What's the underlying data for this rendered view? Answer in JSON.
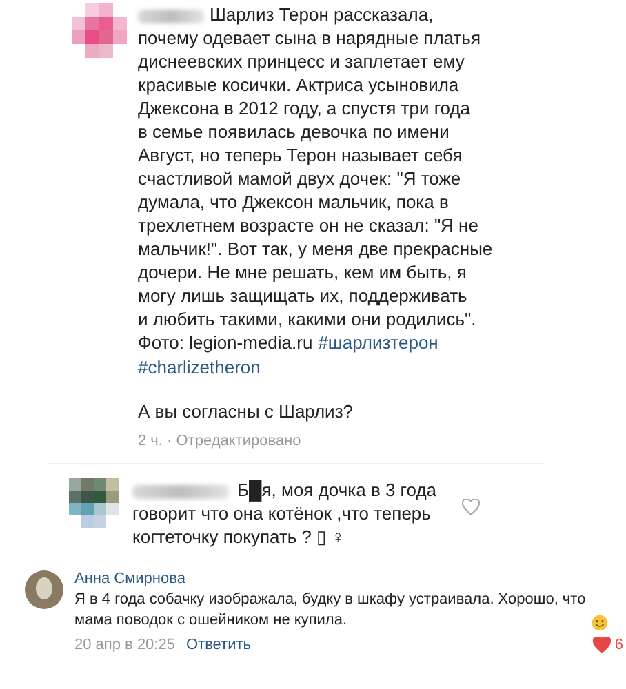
{
  "post": {
    "body": "Шарлиз Терон рассказала,\nпочему одевает сына в нарядные платья\nдиснеевских принцесс и заплетает ему\nкрасивые косички. Актриса усыновила\nДжексона в 2012 году, а спустя три года\nв семье появилась девочка по имени\nАвгуст, но теперь Терон называет себя\nсчастливой мамой двух дочек: \"Я тоже\nдумала, что Джексон мальчик, пока в\nтрехлетнем возрасте он не сказал: \"Я не\nмальчик!\". Вот так, у меня две прекрасные\nдочери. Не мне решать, кем им быть, я\nмогу лишь защищать их, поддерживать\nи любить такими, какими они родились\".",
    "photo_credit": "Фото: legion-media.ru",
    "hashtags": [
      "#шарлизтерон",
      "#charlizetheron"
    ],
    "question": "А вы согласны с Шарлиз?",
    "meta": "2 ч. · Отредактировано"
  },
  "reply": {
    "text": "Б█я, моя дочка в 3 года\nговорит что она котёнок ,что теперь\nкогтеточку покупать ? ▯ ♀",
    "liked": false
  },
  "comment": {
    "author": "Анна Смирнова",
    "text": "Я в 4 года собачку изображала, будку в шкафу устраивала. Хорошо, что\nмама поводок с ошейником не купила.",
    "date": "20 апр в 20:25",
    "reply_link": "Ответить",
    "liked": true,
    "likes": "6"
  }
}
